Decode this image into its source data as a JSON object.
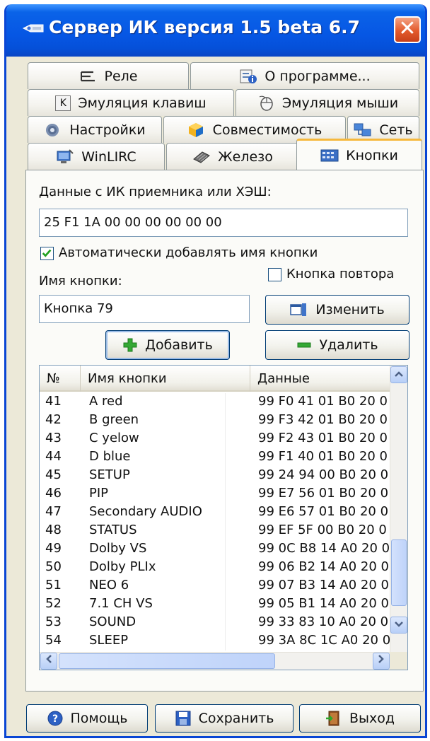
{
  "window": {
    "title": "Сервер ИК версия 1.5 beta 6.7",
    "close_glyph": "✕"
  },
  "tabs": {
    "rele": "Реле",
    "about": "О программе...",
    "keys": "Эмуляция клавиш",
    "mouse": "Эмуляция мыши",
    "settings": "Настройки",
    "compat": "Совместимость",
    "net": "Сеть",
    "winlirc": "WinLIRC",
    "hardware": "Железо",
    "buttons": "Кнопки"
  },
  "panel": {
    "data_label": "Данные с ИК приемника или ХЭШ:",
    "data_value": "25 F1 1A 00 00 00 00 00 00",
    "auto_name_label": "Автоматически добавлять имя кнопки",
    "auto_name_checked": true,
    "repeat_label": "Кнопка повтора",
    "repeat_checked": false,
    "name_label": "Имя кнопки:",
    "name_value": "Кнопка 79",
    "change_button": "Изменить",
    "add_button": "Добавить",
    "delete_button": "Удалить"
  },
  "list": {
    "columns": [
      "№",
      "Имя кнопки",
      "Данные"
    ],
    "rows": [
      {
        "num": "41",
        "name": "A red",
        "data": "99 F0 41 01 B0 20 0"
      },
      {
        "num": "42",
        "name": "B green",
        "data": "99 F3 42 01 B0 20 0"
      },
      {
        "num": "43",
        "name": "C yelow",
        "data": "99 F2 43 01 B0 20 0"
      },
      {
        "num": "44",
        "name": "D blue",
        "data": "99 F1 40 01 B0 20 0"
      },
      {
        "num": "45",
        "name": "SETUP",
        "data": "99 24 94 00 B0 20 0"
      },
      {
        "num": "46",
        "name": "PIP",
        "data": "99 E7 56 01 B0 20 0"
      },
      {
        "num": "47",
        "name": "Secondary AUDIO",
        "data": "99 E6 57 01 B0 20 0"
      },
      {
        "num": "48",
        "name": "STATUS",
        "data": "99 EF 5F 00 B0 20 0"
      },
      {
        "num": "49",
        "name": "Dolby VS",
        "data": "99 0C B8 14 A0 20 0"
      },
      {
        "num": "50",
        "name": "Dolby PLIx",
        "data": "99 06 B2 14 A0 20 0"
      },
      {
        "num": "51",
        "name": "NEO 6",
        "data": "99 07 B3 14 A0 20 0"
      },
      {
        "num": "52",
        "name": "7.1 CH VS",
        "data": "99 05 B1 14 A0 20 0"
      },
      {
        "num": "53",
        "name": "SOUND",
        "data": "99 33 83 10 A0 20 0"
      },
      {
        "num": "54",
        "name": "SLEEP",
        "data": "99 3A 8C 1C A0 20 0"
      }
    ]
  },
  "footer": {
    "help": "Помощь",
    "save": "Сохранить",
    "exit": "Выход"
  },
  "colors": {
    "titlebar": "#0656e4",
    "active_tab_accent": "#f6b83c",
    "close_button": "#e35a2c"
  }
}
